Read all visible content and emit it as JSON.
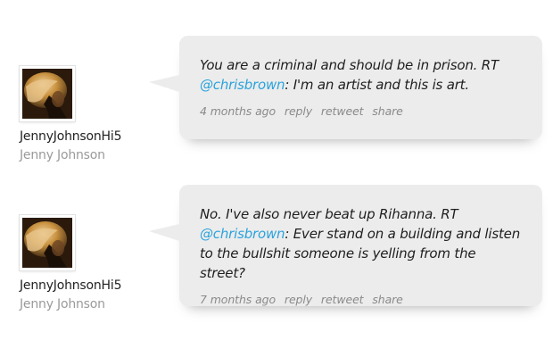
{
  "tweets": [
    {
      "author": {
        "handle": "JennyJohnsonHi5",
        "name": "Jenny Johnson"
      },
      "text_before": "You are a criminal and should be in prison. RT ",
      "mention": "@chrisbrown",
      "text_after": ": I'm an artist and this is art.",
      "time": "4 months ago",
      "actions": {
        "reply": "reply",
        "retweet": "retweet",
        "share": "share"
      }
    },
    {
      "author": {
        "handle": "JennyJohnsonHi5",
        "name": "Jenny Johnson"
      },
      "text_before": "No. I've also never beat up Rihanna. RT ",
      "mention": "@chrisbrown",
      "text_after": ": Ever stand on a building and listen to the bullshit someone is yelling from the street?",
      "time": "7 months ago",
      "actions": {
        "reply": "reply",
        "retweet": "retweet",
        "share": "share"
      }
    }
  ],
  "colors": {
    "bubble": "#ececec",
    "mention": "#2aa3dc",
    "handle": "#222222",
    "realname": "#9a9a9a",
    "meta": "#8a8a8a"
  }
}
